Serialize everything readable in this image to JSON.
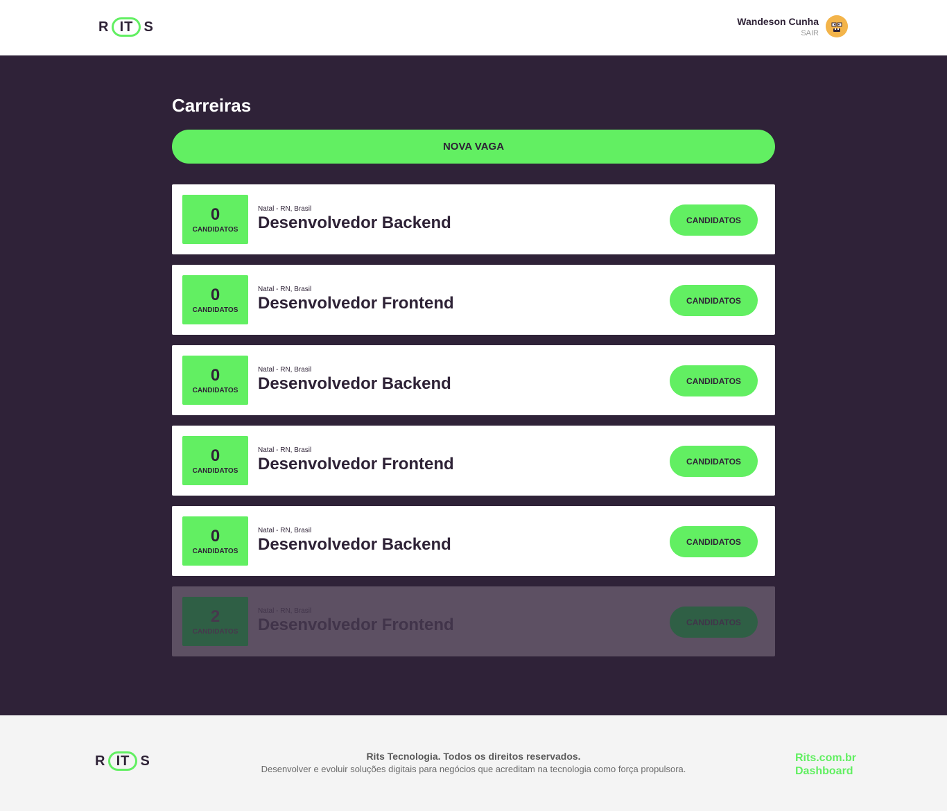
{
  "header": {
    "logo": {
      "left": "R",
      "middle": "IT",
      "right": "S"
    },
    "user": {
      "name": "Wandeson Cunha",
      "logout_label": "SAIR"
    }
  },
  "main": {
    "title": "Carreiras",
    "new_job_label": "NOVA VAGA",
    "jobs": [
      {
        "count": "0",
        "count_label": "CANDIDATOS",
        "location": "Natal - RN, Brasil",
        "title": "Desenvolvedor Backend",
        "button": "CANDIDATOS"
      },
      {
        "count": "0",
        "count_label": "CANDIDATOS",
        "location": "Natal - RN, Brasil",
        "title": "Desenvolvedor Frontend",
        "button": "CANDIDATOS"
      },
      {
        "count": "0",
        "count_label": "CANDIDATOS",
        "location": "Natal - RN, Brasil",
        "title": "Desenvolvedor Backend",
        "button": "CANDIDATOS"
      },
      {
        "count": "0",
        "count_label": "CANDIDATOS",
        "location": "Natal - RN, Brasil",
        "title": "Desenvolvedor Frontend",
        "button": "CANDIDATOS"
      },
      {
        "count": "0",
        "count_label": "CANDIDATOS",
        "location": "Natal - RN, Brasil",
        "title": "Desenvolvedor Backend",
        "button": "CANDIDATOS"
      },
      {
        "count": "2",
        "count_label": "CANDIDATOS",
        "location": "Natal - RN, Brasil",
        "title": "Desenvolvedor Frontend",
        "button": "CANDIDATOS"
      }
    ]
  },
  "footer": {
    "logo": {
      "left": "R",
      "middle": "IT",
      "right": "S"
    },
    "copyright": "Rits Tecnologia. Todos os direitos reservados.",
    "tagline": "Desenvolver e evoluir soluções digitais para negócios que acreditam na tecnologia como força propulsora.",
    "links": [
      "Rits.com.br",
      "Dashboard"
    ]
  },
  "colors": {
    "accent": "#62ef62",
    "background_dark": "#2f2238",
    "text_dark": "#2e2236"
  }
}
